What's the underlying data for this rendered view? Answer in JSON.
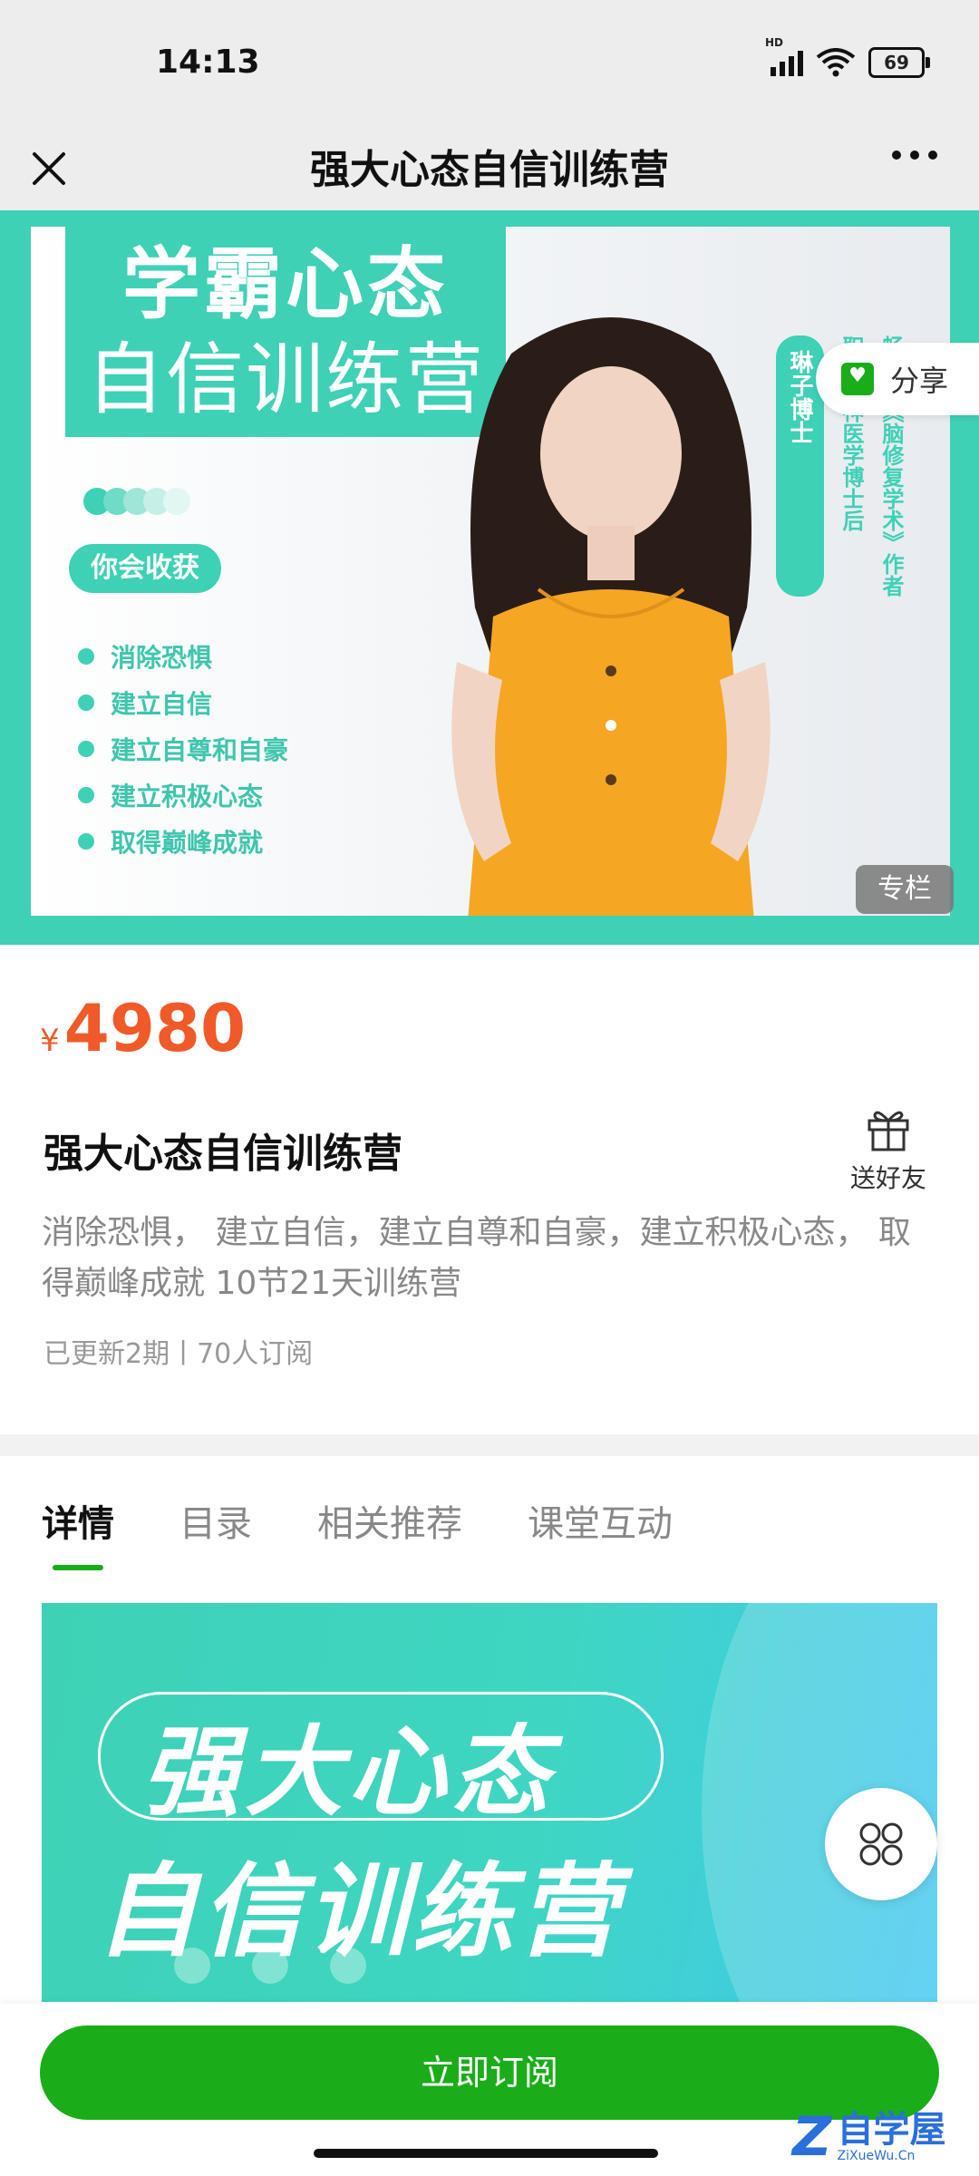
{
  "status_bar": {
    "time": "14:13",
    "network": "HD",
    "battery": "69"
  },
  "nav": {
    "title": "强大心态自信训练营"
  },
  "banner": {
    "title_line1": "学霸心态",
    "title_line2": "自信训练营",
    "gain_label": "你会收获",
    "bullets": [
      "消除恐惧",
      "建立自信",
      "建立自尊和自豪",
      "建立积极心态",
      "取得巅峰成就"
    ],
    "author_tag": "琳子博士",
    "author_line1": "职业精神医学博士后",
    "author_line2": "畅销书《脑修复学术》作者",
    "share_label": "分享",
    "column_badge": "专栏",
    "dot_colors": [
      "#3ed1b6",
      "#6fdcc8",
      "#9fe6d8",
      "#c6f0e7",
      "#e2f7f2"
    ]
  },
  "product": {
    "currency": "¥",
    "price": "4980",
    "title": "强大心态自信训练营",
    "gift_label": "送好友",
    "description": "消除恐惧， 建立自信，建立自尊和自豪，建立积极心态， 取得巅峰成就 10节21天训练营",
    "meta": "已更新2期丨70人订阅"
  },
  "tabs": [
    "详情",
    "目录",
    "相关推荐",
    "课堂互动"
  ],
  "detail": {
    "line1": "强大心态",
    "line2": "自信训练营"
  },
  "bottom": {
    "subscribe_label": "立即订阅"
  },
  "watermark": {
    "cn": "自学屋",
    "en": "ZiXueWu.Cn"
  },
  "colors": {
    "accent": "#1aad19",
    "teal": "#3ed1b6",
    "price": "#f05a28"
  }
}
